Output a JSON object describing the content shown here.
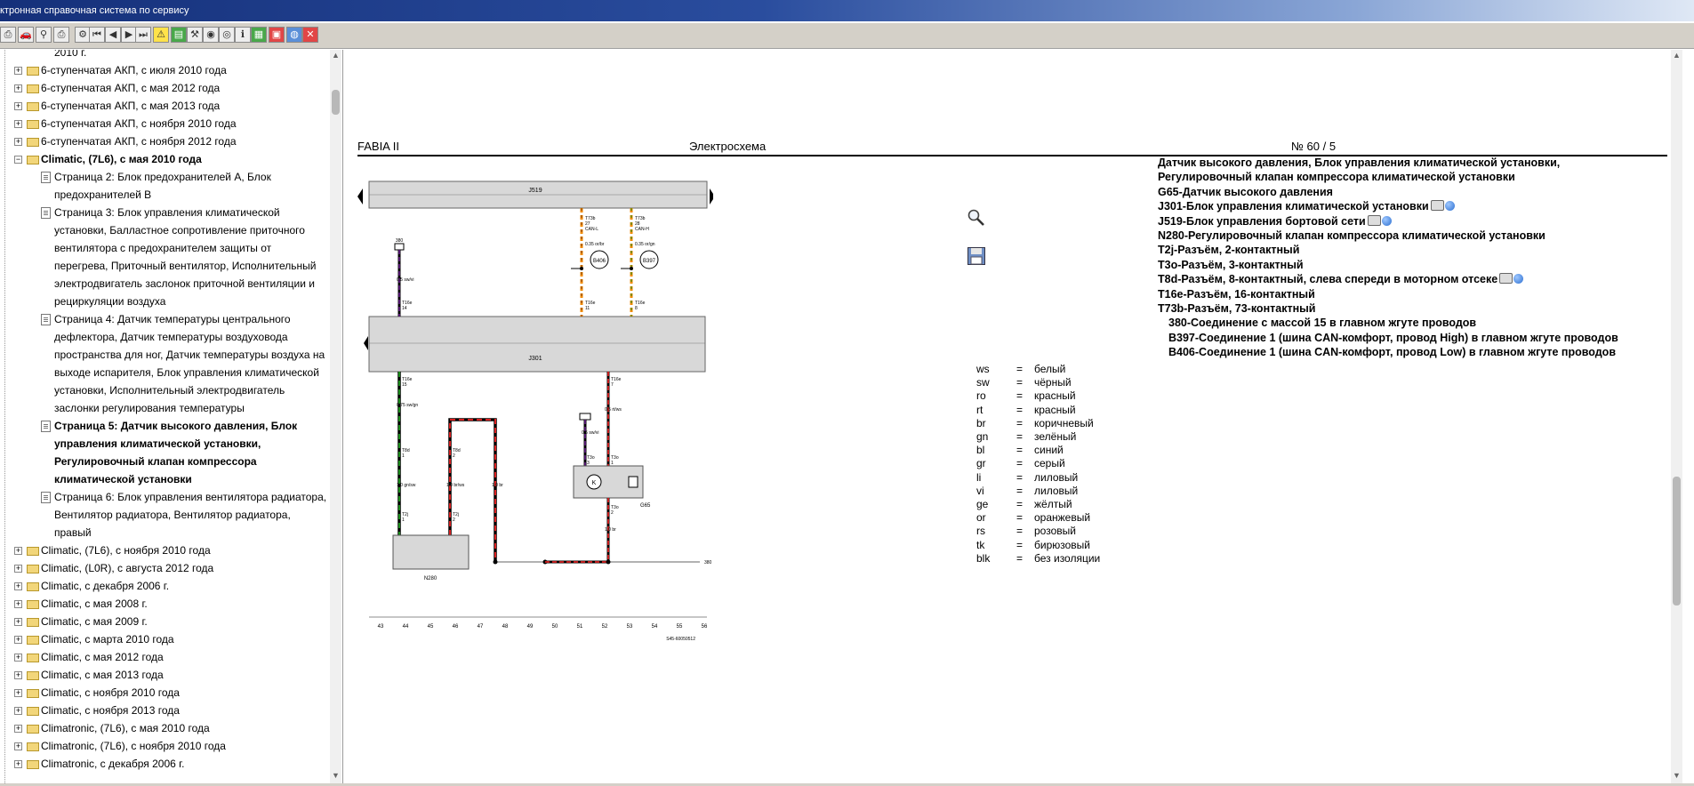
{
  "window": {
    "title": "ктронная справочная система по сервису"
  },
  "colors": {
    "title_bar": "#15307a",
    "wire_red": "#d91f1f",
    "wire_green": "#1a8a1a",
    "wire_orange": "#f08a00",
    "wire_violet": "#6a1d8f"
  },
  "toolbar": {
    "icons": [
      "print-icon",
      "car-icon",
      "search-icon",
      "printer-icon",
      "settings-icon",
      "first-page-icon",
      "prev-page-icon",
      "next-page-icon",
      "last-page-icon",
      "warning-icon",
      "book-icon",
      "tool-icon",
      "camera-icon",
      "eye-icon",
      "info-icon",
      "truck-icon",
      "document-icon",
      "globe-icon",
      "exit-icon"
    ]
  },
  "tree": {
    "items": [
      {
        "label": "2010 г.",
        "indent": 2,
        "bold": false,
        "type": "text"
      },
      {
        "label": "6-ступенчатая АКП, с июля 2010 года",
        "indent": 1,
        "bold": false,
        "type": "folder"
      },
      {
        "label": "6-ступенчатая АКП, с мая 2012 года",
        "indent": 1,
        "bold": false,
        "type": "folder"
      },
      {
        "label": "6-ступенчатая АКП, с мая 2013 года",
        "indent": 1,
        "bold": false,
        "type": "folder"
      },
      {
        "label": "6-ступенчатая АКП, с ноября 2010 года",
        "indent": 1,
        "bold": false,
        "type": "folder"
      },
      {
        "label": "6-ступенчатая АКП, с ноября 2012 года",
        "indent": 1,
        "bold": false,
        "type": "folder"
      },
      {
        "label": "Climatic, (7L6), с мая 2010 года",
        "indent": 1,
        "bold": true,
        "type": "folder-open"
      },
      {
        "label": "Страница 2: Блок предохранителей А, Блок",
        "indent": 2,
        "bold": false,
        "type": "page"
      },
      {
        "label": "предохранителей В",
        "indent": 2,
        "bold": false,
        "type": "text"
      },
      {
        "label": "Страница 3: Блок управления климатической",
        "indent": 2,
        "bold": false,
        "type": "page"
      },
      {
        "label": "установки, Балластное сопротивление приточного",
        "indent": 2,
        "bold": false,
        "type": "text"
      },
      {
        "label": "вентилятора с предохранителем защиты от",
        "indent": 2,
        "bold": false,
        "type": "text"
      },
      {
        "label": "перегрева, Приточный вентилятор, Исполнительный",
        "indent": 2,
        "bold": false,
        "type": "text"
      },
      {
        "label": "электродвигатель заслонок приточной вентиляции и",
        "indent": 2,
        "bold": false,
        "type": "text"
      },
      {
        "label": "рециркуляции воздуха",
        "indent": 2,
        "bold": false,
        "type": "text"
      },
      {
        "label": "Страница 4: Датчик температуры центрального",
        "indent": 2,
        "bold": false,
        "type": "page"
      },
      {
        "label": "дефлектора, Датчик температуры воздуховода",
        "indent": 2,
        "bold": false,
        "type": "text"
      },
      {
        "label": "пространства для ног, Датчик температуры воздуха на",
        "indent": 2,
        "bold": false,
        "type": "text"
      },
      {
        "label": "выходе испарителя, Блок управления климатической",
        "indent": 2,
        "bold": false,
        "type": "text"
      },
      {
        "label": "установки, Исполнительный электродвигатель",
        "indent": 2,
        "bold": false,
        "type": "text"
      },
      {
        "label": "заслонки регулирования температуры",
        "indent": 2,
        "bold": false,
        "type": "text"
      },
      {
        "label": "Страница 5: Датчик высокого давления, Блок",
        "indent": 2,
        "bold": true,
        "type": "page"
      },
      {
        "label": "управления климатической установки,",
        "indent": 2,
        "bold": true,
        "type": "text"
      },
      {
        "label": "Регулировочный клапан компрессора",
        "indent": 2,
        "bold": true,
        "type": "text"
      },
      {
        "label": "климатической установки",
        "indent": 2,
        "bold": true,
        "type": "text"
      },
      {
        "label": "Страница 6: Блок управления вентилятора радиатора,",
        "indent": 2,
        "bold": false,
        "type": "page"
      },
      {
        "label": "Вентилятор радиатора, Вентилятор радиатора,",
        "indent": 2,
        "bold": false,
        "type": "text"
      },
      {
        "label": "правый",
        "indent": 2,
        "bold": false,
        "type": "text"
      },
      {
        "label": "Climatic, (7L6), с ноября 2010 года",
        "indent": 1,
        "bold": false,
        "type": "folder"
      },
      {
        "label": "Climatic, (L0R), с августа 2012 года",
        "indent": 1,
        "bold": false,
        "type": "folder"
      },
      {
        "label": "Climatic, с декабря 2006 г.",
        "indent": 1,
        "bold": false,
        "type": "folder"
      },
      {
        "label": "Climatic, с мая 2008 г.",
        "indent": 1,
        "bold": false,
        "type": "folder"
      },
      {
        "label": "Climatic, с мая 2009 г.",
        "indent": 1,
        "bold": false,
        "type": "folder"
      },
      {
        "label": "Climatic, с марта 2010 года",
        "indent": 1,
        "bold": false,
        "type": "folder"
      },
      {
        "label": "Climatic, с мая 2012 года",
        "indent": 1,
        "bold": false,
        "type": "folder"
      },
      {
        "label": "Climatic, с мая 2013 года",
        "indent": 1,
        "bold": false,
        "type": "folder"
      },
      {
        "label": "Climatic, с ноября 2010 года",
        "indent": 1,
        "bold": false,
        "type": "folder"
      },
      {
        "label": "Climatic, с ноября 2013 года",
        "indent": 1,
        "bold": false,
        "type": "folder"
      },
      {
        "label": "Climatronic, (7L6), с мая 2010 года",
        "indent": 1,
        "bold": false,
        "type": "folder"
      },
      {
        "label": "Climatronic, (7L6), с ноября 2010 года",
        "indent": 1,
        "bold": false,
        "type": "folder"
      },
      {
        "label": "Climatronic, с декабря 2006 г.",
        "indent": 1,
        "bold": false,
        "type": "folder"
      }
    ]
  },
  "document": {
    "header_left": "FABIA II",
    "header_center": "Электросхема",
    "header_right": "№  60 / 5",
    "descriptions": [
      {
        "text": "Датчик высокого давления, Блок управления климатической установки,",
        "icons": false,
        "sub": false
      },
      {
        "text": "Регулировочный клапан компрессора климатической установки",
        "icons": false,
        "sub": false
      },
      {
        "text": "G65-Датчик высокого давления",
        "icons": false,
        "sub": false
      },
      {
        "text": "J301-Блок управления климатической установки",
        "icons": true,
        "sub": false
      },
      {
        "text": "J519-Блок управления бортовой сети",
        "icons": true,
        "sub": false
      },
      {
        "text": "N280-Регулировочный клапан компрессора климатической установки",
        "icons": false,
        "sub": false
      },
      {
        "text": "T2j-Разъём, 2-контактный",
        "icons": false,
        "sub": false
      },
      {
        "text": "T3o-Разъём, 3-контактный",
        "icons": false,
        "sub": false
      },
      {
        "text": "T8d-Разъём, 8-контактный, слева спереди в моторном отсеке",
        "icons": true,
        "sub": false
      },
      {
        "text": "T16e-Разъём, 16-контактный",
        "icons": false,
        "sub": false
      },
      {
        "text": "T73b-Разъём, 73-контактный",
        "icons": false,
        "sub": false
      },
      {
        "text": "380-Соединение с массой 15 в главном жгуте проводов",
        "icons": false,
        "sub": true
      },
      {
        "text": "B397-Соединение 1 (шина CAN-комфорт, провод High) в главном жгуте проводов",
        "icons": false,
        "sub": true
      },
      {
        "text": "B406-Соединение 1 (шина CAN-комфорт, провод Low) в главном жгуте проводов",
        "icons": false,
        "sub": true
      }
    ],
    "legend": [
      {
        "code": "ws",
        "eq": "=",
        "name": "белый"
      },
      {
        "code": "sw",
        "eq": "=",
        "name": "чёрный"
      },
      {
        "code": "ro",
        "eq": "=",
        "name": "красный"
      },
      {
        "code": "rt",
        "eq": "=",
        "name": "красный"
      },
      {
        "code": "br",
        "eq": "=",
        "name": "коричневый"
      },
      {
        "code": "gn",
        "eq": "=",
        "name": "зелёный"
      },
      {
        "code": "bl",
        "eq": "=",
        "name": "синий"
      },
      {
        "code": "gr",
        "eq": "=",
        "name": "серый"
      },
      {
        "code": "li",
        "eq": "=",
        "name": "лиловый"
      },
      {
        "code": "vi",
        "eq": "=",
        "name": "лиловый"
      },
      {
        "code": "ge",
        "eq": "=",
        "name": "жёлтый"
      },
      {
        "code": "or",
        "eq": "=",
        "name": "оранжевый"
      },
      {
        "code": "rs",
        "eq": "=",
        "name": "розовый"
      },
      {
        "code": "tk",
        "eq": "=",
        "name": "бирюзовый"
      },
      {
        "code": "blk",
        "eq": "=",
        "name": "без изоляции"
      }
    ],
    "diagram": {
      "j519_label": "J519",
      "j301_label": "J301",
      "n280_label": "N280",
      "g65_label": "G65",
      "b406_label": "B406",
      "b397_label": "B397",
      "k_label": "K",
      "ref_380": "380",
      "t73b_label": "T73b",
      "t73b_pin_a": "27",
      "t73b_pin_b": "28",
      "can_l": "CAN-L",
      "can_h": "CAN-H",
      "t16e_label": "T16e",
      "t16e_pin_a": "14",
      "t16e_pin_b": "11",
      "t16e_pin_c": "8",
      "t16e_pin_d": "7",
      "t16e_pin_e": "15",
      "t8d_label": "T8d",
      "t8d_pin_a": "1",
      "t8d_pin_b": "2",
      "t2j_label": "T2j",
      "t2j_pin_a": "1",
      "t2j_pin_b": "2",
      "t3o_label": "T3o",
      "t3o_pin_a": "3",
      "t3o_pin_b": "1",
      "t3o_pin_c": "2",
      "wire_a": "0.35 or/br",
      "wire_b": "0.35 or/gn",
      "wire_c": "0.5 sw/vi",
      "wire_d": "0.75 sw/gn",
      "wire_e": "1.0 gn/sw",
      "wire_f": "1.0 br/ws",
      "wire_g": "1.0 br",
      "wire_h": "0.5 rt/ws",
      "grid": [
        "43",
        "44",
        "45",
        "46",
        "47",
        "48",
        "49",
        "50",
        "51",
        "52",
        "53",
        "54",
        "55",
        "56"
      ],
      "stamp": "S45-60050512"
    }
  }
}
